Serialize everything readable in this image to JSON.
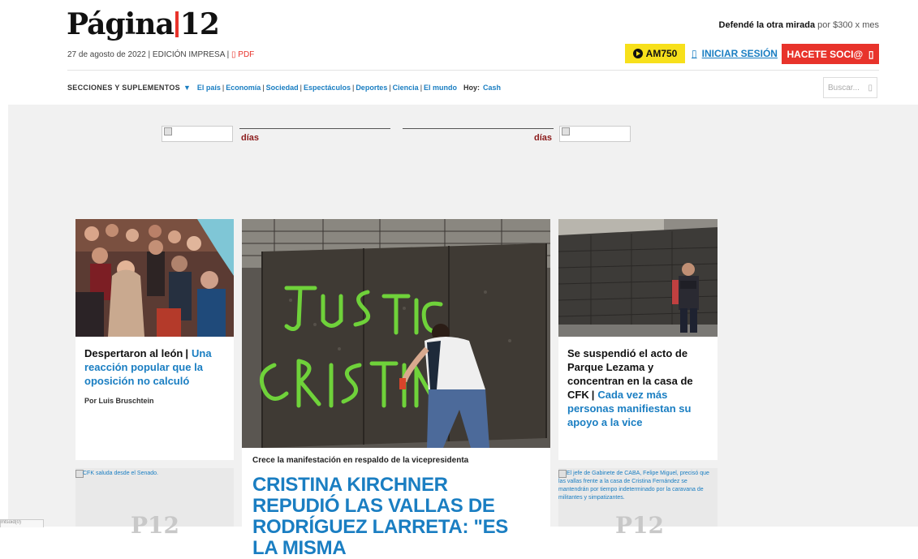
{
  "header": {
    "logo_text": "Página",
    "logo_number": "12",
    "date": "27 de agosto de 2022",
    "edition": "EDICIÓN IMPRESA",
    "pdf_label": "PDF",
    "promo_bold": "Defendé la otra mirada",
    "promo_rest": " por $300 x mes",
    "radio_label": "AM750",
    "login_label": "INICIAR SESIÓN",
    "socio_label": "HACETE SOCI@",
    "accent": "#e8332b",
    "link_color": "#1a7ec2"
  },
  "nav": {
    "secciones_label": "SECCIONES Y SUPLEMENTOS",
    "links": [
      "El país",
      "Economía",
      "Sociedad",
      "Espectáculos",
      "Deportes",
      "Ciencia",
      "El mundo"
    ],
    "hoy_label": "Hoy:",
    "hoy_link": "Cash"
  },
  "search": {
    "placeholder": "Buscar..."
  },
  "banner": {
    "dias_label_left": "días",
    "dias_label_right": "días"
  },
  "stories": {
    "left": {
      "kicker": "Despertaron al león",
      "headline": "Una reacción popular que la oposición no calculó",
      "author": "Por Luis Bruschtein"
    },
    "center": {
      "subtitle": "Crece la manifestación en respaldo de la vicepresidenta",
      "headline": "CRISTINA KIRCHNER REPUDIÓ LAS VALLAS DE RODRÍGUEZ LARRETA: \"ES LA MISMA"
    },
    "right": {
      "kicker": "Se suspendió el acto de Parque Lezama y concentran en la casa de CFK",
      "headline": "Cada vez más personas manifiestan su apoyo a la vice"
    },
    "bottom_left_alt": "CFK saluda desde el Senado.",
    "bottom_right_alt": "El jefe de Gabinete de CABA, Felipe Miguel, precisó que las vallas frente a la casa de Cristina Fernández se mantendrán por tiempo indeterminado por la caravana de militantes y simpatizantes.",
    "placeholder_mark": "P12"
  },
  "footer": {
    "tab_label": "mtsoid(0)"
  }
}
